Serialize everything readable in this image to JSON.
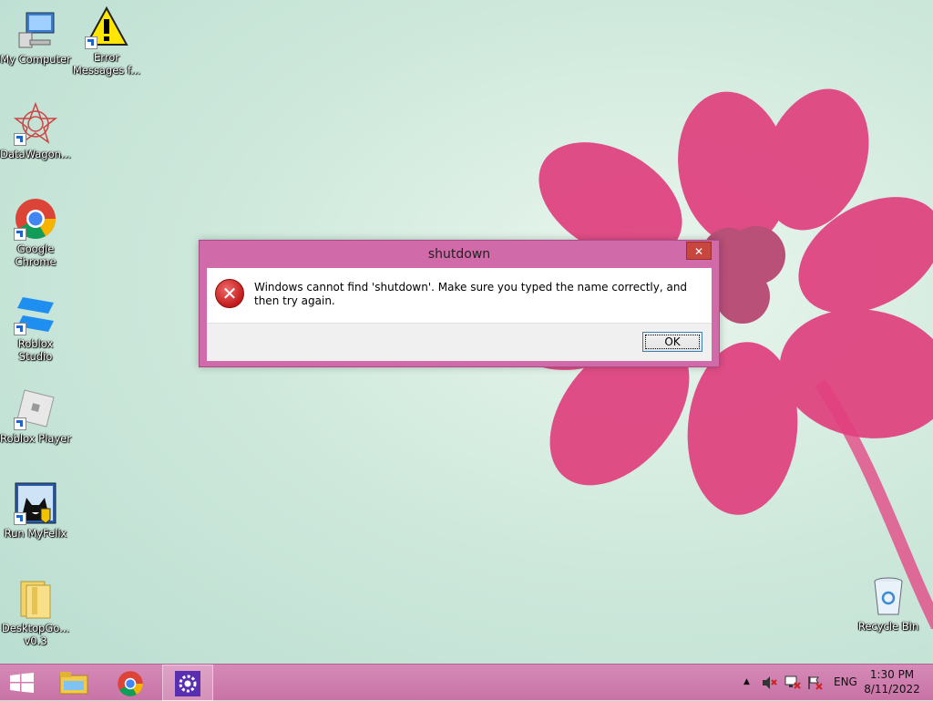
{
  "desktop": {
    "icons": [
      {
        "label": "My Computer"
      },
      {
        "label": "Error Messages f..."
      },
      {
        "label": "DataWagon..."
      },
      {
        "label": "Google Chrome"
      },
      {
        "label": "Roblox Studio"
      },
      {
        "label": "Roblox Player"
      },
      {
        "label": "Run MyFelix"
      },
      {
        "label": "DesktopGo... v0.3"
      },
      {
        "label": "Recycle Bin"
      }
    ]
  },
  "dialog": {
    "title": "shutdown",
    "close_label": "✕",
    "icon": "error-icon",
    "message": "Windows cannot find 'shutdown'. Make sure you typed the name correctly, and then try again.",
    "ok_label": "OK"
  },
  "taskbar": {
    "pinned": [
      "start-icon",
      "file-explorer-icon",
      "chrome-icon",
      "settings-icon"
    ],
    "active_index": 3,
    "tray": {
      "language": "ENG",
      "time": "1:30 PM",
      "date": "8/11/2022"
    }
  },
  "colors": {
    "taskbar": "#c873a6",
    "dialog_frame": "#d06aa8",
    "close_button": "#c7463f",
    "wallpaper_flower": "#e0407e"
  }
}
